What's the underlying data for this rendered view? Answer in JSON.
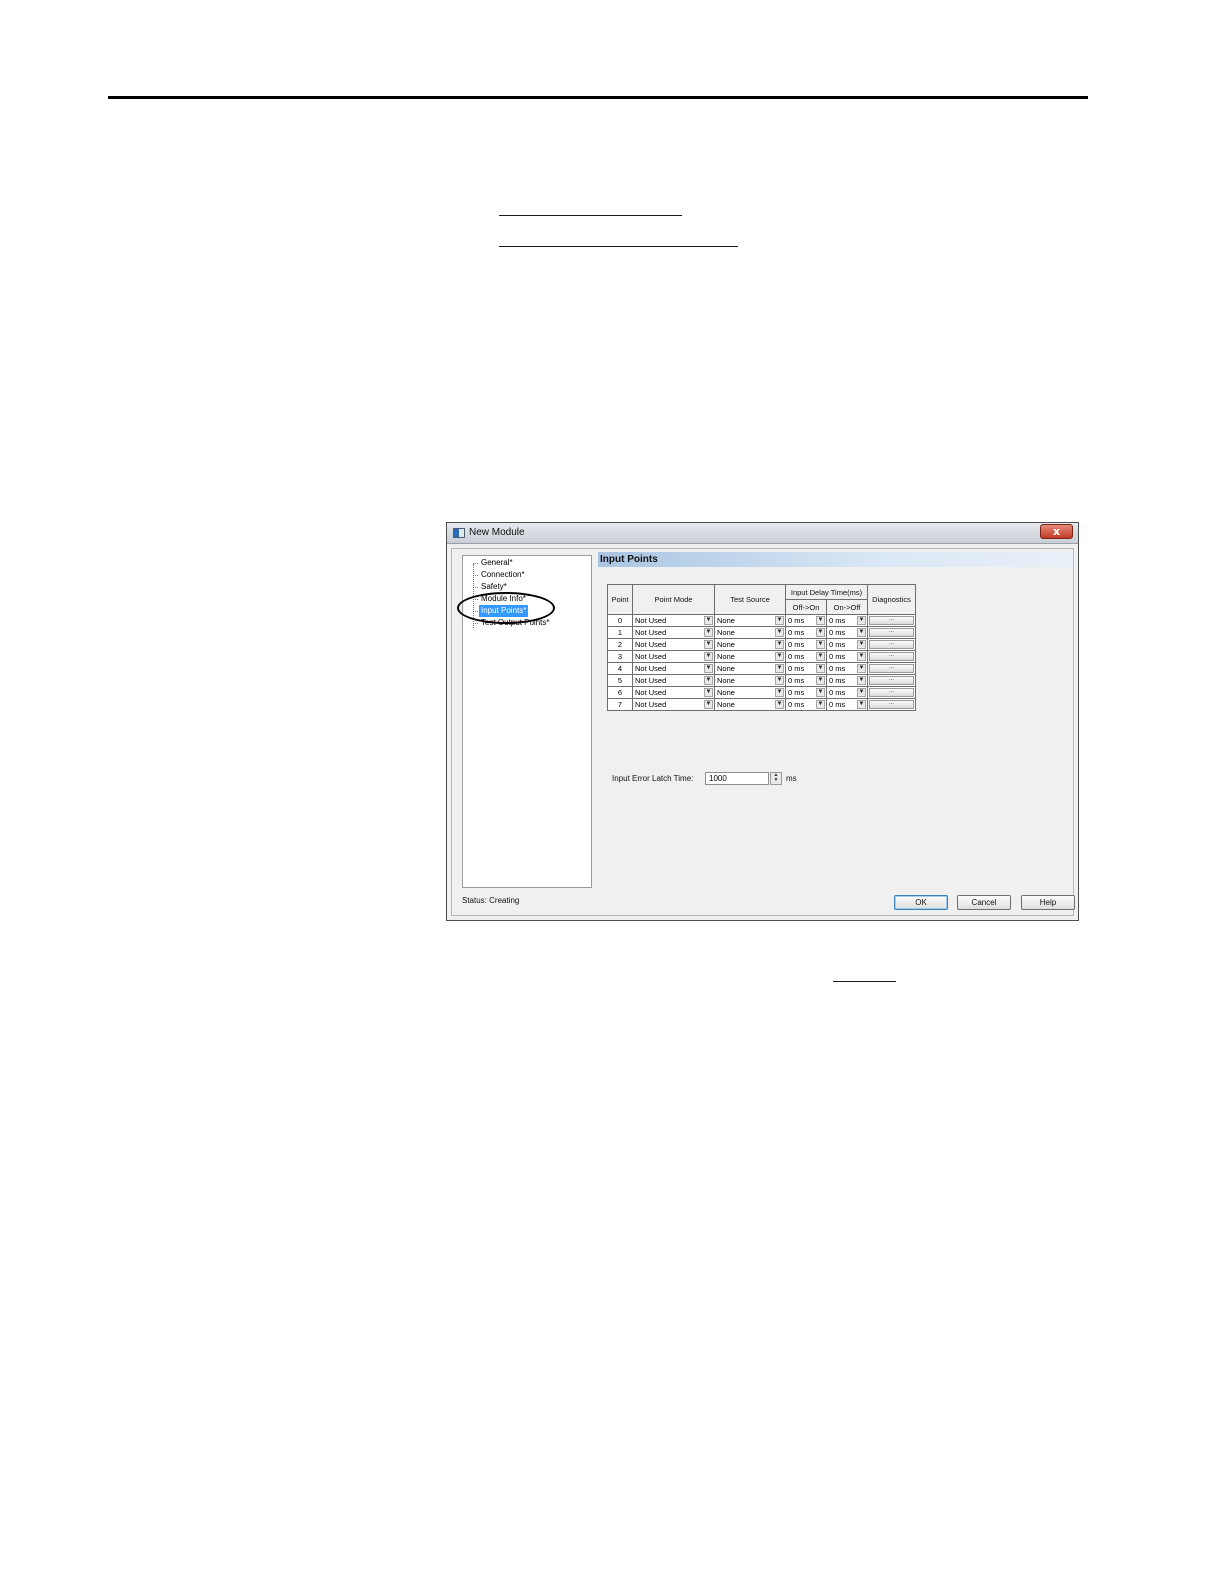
{
  "dialog": {
    "title": "New Module",
    "close_label": "x",
    "tree": {
      "items": [
        {
          "label": "General*"
        },
        {
          "label": "Connection*"
        },
        {
          "label": "Safety*"
        },
        {
          "label": "Module Info*"
        },
        {
          "label": "Input Points*",
          "selected": true
        },
        {
          "label": "Test Output Points*"
        }
      ]
    },
    "panel": {
      "title": "Input Points",
      "table": {
        "headers": {
          "point": "Point",
          "point_mode": "Point Mode",
          "test_source": "Test Source",
          "input_delay": "Input Delay Time(ms)",
          "off_on": "Off->On",
          "on_off": "On->Off",
          "diagnostics": "Diagnostics"
        },
        "rows": [
          {
            "point": "0",
            "mode": "Not Used",
            "source": "None",
            "off_on": "0 ms",
            "on_off": "0 ms",
            "diag": "..."
          },
          {
            "point": "1",
            "mode": "Not Used",
            "source": "None",
            "off_on": "0 ms",
            "on_off": "0 ms",
            "diag": "..."
          },
          {
            "point": "2",
            "mode": "Not Used",
            "source": "None",
            "off_on": "0 ms",
            "on_off": "0 ms",
            "diag": "..."
          },
          {
            "point": "3",
            "mode": "Not Used",
            "source": "None",
            "off_on": "0 ms",
            "on_off": "0 ms",
            "diag": "..."
          },
          {
            "point": "4",
            "mode": "Not Used",
            "source": "None",
            "off_on": "0 ms",
            "on_off": "0 ms",
            "diag": "..."
          },
          {
            "point": "5",
            "mode": "Not Used",
            "source": "None",
            "off_on": "0 ms",
            "on_off": "0 ms",
            "diag": "..."
          },
          {
            "point": "6",
            "mode": "Not Used",
            "source": "None",
            "off_on": "0 ms",
            "on_off": "0 ms",
            "diag": "..."
          },
          {
            "point": "7",
            "mode": "Not Used",
            "source": "None",
            "off_on": "0 ms",
            "on_off": "0 ms",
            "diag": "..."
          }
        ]
      },
      "latch": {
        "label": "Input Error Latch Time:",
        "value": "1000",
        "unit": "ms"
      }
    },
    "status": "Status:  Creating",
    "buttons": {
      "ok": "OK",
      "cancel": "Cancel",
      "help": "Help"
    }
  }
}
